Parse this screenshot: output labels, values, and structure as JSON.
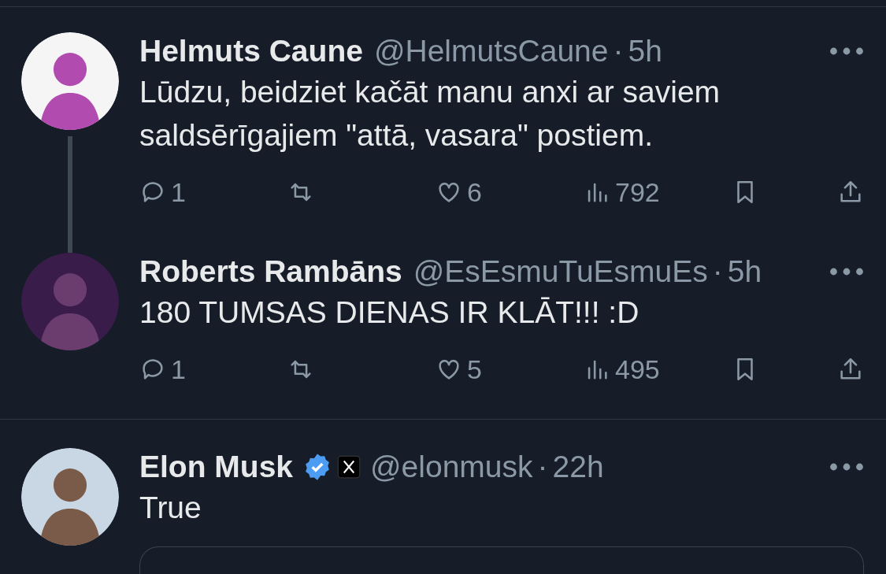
{
  "tweets": [
    {
      "name": "Helmuts Caune",
      "handle": "@HelmutsCaune",
      "dot": "·",
      "time": "5h",
      "text": "Lūdzu, beidziet kačāt manu anxi ar saviem saldsērīgajiem \"attā, vasara\" postiem.",
      "thread_continues": true,
      "actions": {
        "replies": "1",
        "likes": "6",
        "views": "792"
      }
    },
    {
      "name": "Roberts Rambāns",
      "handle": "@EsEsmuTuEsmuEs",
      "dot": "·",
      "time": "5h",
      "text": "180 TUMSAS DIENAS IR KLĀT!!! :D",
      "thread_continues": false,
      "actions": {
        "replies": "1",
        "likes": "5",
        "views": "495"
      }
    },
    {
      "name": "Elon Musk",
      "verified": true,
      "affiliate": true,
      "handle": "@elonmusk",
      "dot": "·",
      "time": "22h",
      "text": "True",
      "thread_continues": false,
      "quote_card": true
    }
  ]
}
